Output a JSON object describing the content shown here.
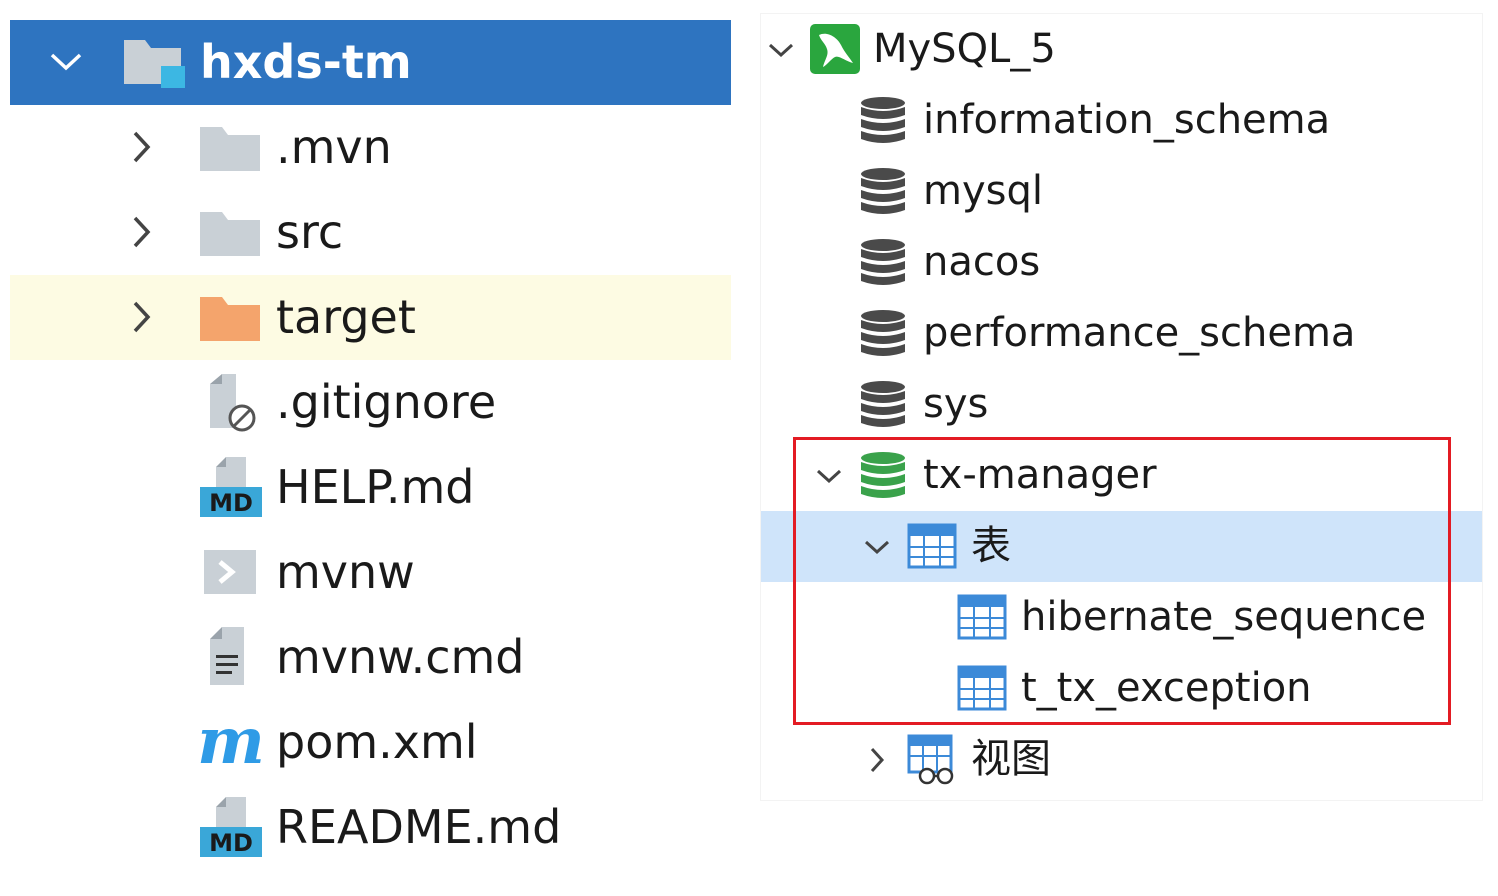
{
  "project_tree": {
    "root": {
      "label": "hxds-tm",
      "icon": "module-folder-icon",
      "expanded": true
    },
    "items": [
      {
        "label": ".mvn",
        "icon": "folder-icon",
        "expandable": true
      },
      {
        "label": "src",
        "icon": "folder-icon",
        "expandable": true
      },
      {
        "label": "target",
        "icon": "excluded-folder-icon",
        "expandable": true
      },
      {
        "label": ".gitignore",
        "icon": "ignored-file-icon",
        "expandable": false
      },
      {
        "label": "HELP.md",
        "icon": "markdown-file-icon",
        "icon_text": "MD",
        "expandable": false
      },
      {
        "label": "mvnw",
        "icon": "shell-script-icon",
        "expandable": false
      },
      {
        "label": "mvnw.cmd",
        "icon": "text-file-icon",
        "expandable": false
      },
      {
        "label": "pom.xml",
        "icon": "maven-icon",
        "icon_text": "m",
        "expandable": false
      },
      {
        "label": "README.md",
        "icon": "markdown-file-icon",
        "icon_text": "MD",
        "expandable": false
      }
    ]
  },
  "db_tree": {
    "connection": {
      "label": "MySQL_5",
      "icon": "mysql-dolphin-icon",
      "expanded": true
    },
    "databases": [
      {
        "label": "information_schema",
        "icon": "database-icon"
      },
      {
        "label": "mysql",
        "icon": "database-icon"
      },
      {
        "label": "nacos",
        "icon": "database-icon"
      },
      {
        "label": "performance_schema",
        "icon": "database-icon"
      },
      {
        "label": "sys",
        "icon": "database-icon"
      }
    ],
    "active_db": {
      "label": "tx-manager",
      "icon": "database-active-icon",
      "expanded": true,
      "tables_group": {
        "label": "表",
        "icon": "tables-icon",
        "expanded": true
      },
      "tables": [
        {
          "label": "hibernate_sequence",
          "icon": "table-icon"
        },
        {
          "label": "t_tx_exception",
          "icon": "table-icon"
        }
      ],
      "views_group": {
        "label": "视图",
        "icon": "views-icon",
        "expanded": false
      }
    }
  },
  "colors": {
    "selection": "#2e74c0",
    "target_row": "#fdfbe3",
    "db_selection": "#cfe4fa",
    "highlight_box": "#e31b23",
    "folder": "#c9d0d6",
    "excluded_folder": "#f4a46c",
    "db_active": "#3aa24b",
    "mysql_green": "#2aa63e",
    "table_blue": "#3c8ad8",
    "maven": "#2f9be6"
  }
}
